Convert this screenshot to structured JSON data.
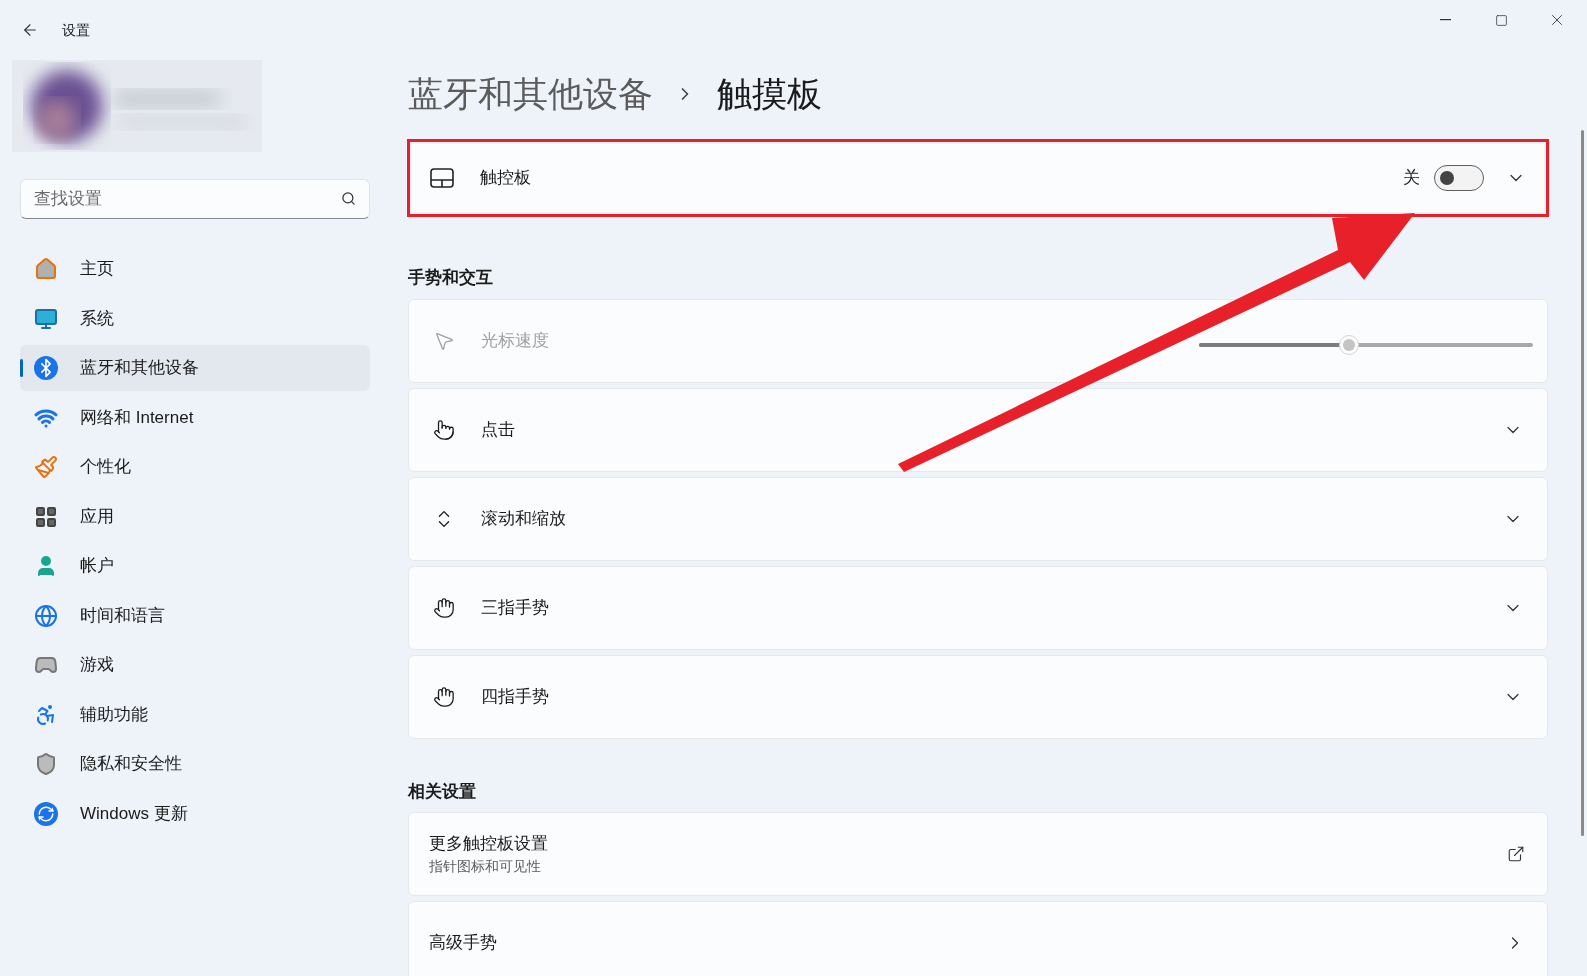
{
  "window": {
    "title": "设置"
  },
  "search": {
    "placeholder": "查找设置"
  },
  "nav": [
    {
      "label": "主页",
      "selected": false
    },
    {
      "label": "系统",
      "selected": false
    },
    {
      "label": "蓝牙和其他设备",
      "selected": true
    },
    {
      "label": "网络和 Internet",
      "selected": false
    },
    {
      "label": "个性化",
      "selected": false
    },
    {
      "label": "应用",
      "selected": false
    },
    {
      "label": "帐户",
      "selected": false
    },
    {
      "label": "时间和语言",
      "selected": false
    },
    {
      "label": "游戏",
      "selected": false
    },
    {
      "label": "辅助功能",
      "selected": false
    },
    {
      "label": "隐私和安全性",
      "selected": false
    },
    {
      "label": "Windows 更新",
      "selected": false
    }
  ],
  "breadcrumb": {
    "parent": "蓝牙和其他设备",
    "current": "触摸板"
  },
  "touchpad": {
    "label": "触控板",
    "state_text": "关",
    "on": false
  },
  "gestures": {
    "heading": "手势和交互",
    "rows": [
      {
        "kind": "slider",
        "label": "光标速度",
        "disabled": true,
        "level": 0.45
      },
      {
        "kind": "expander",
        "label": "点击"
      },
      {
        "kind": "expander",
        "label": "滚动和缩放"
      },
      {
        "kind": "expander",
        "label": "三指手势"
      },
      {
        "kind": "expander",
        "label": "四指手势"
      }
    ]
  },
  "related": {
    "heading": "相关设置",
    "rows": [
      {
        "kind": "external",
        "label": "更多触控板设置",
        "description": "指针图标和可见性"
      },
      {
        "kind": "link",
        "label": "高级手势"
      }
    ]
  }
}
